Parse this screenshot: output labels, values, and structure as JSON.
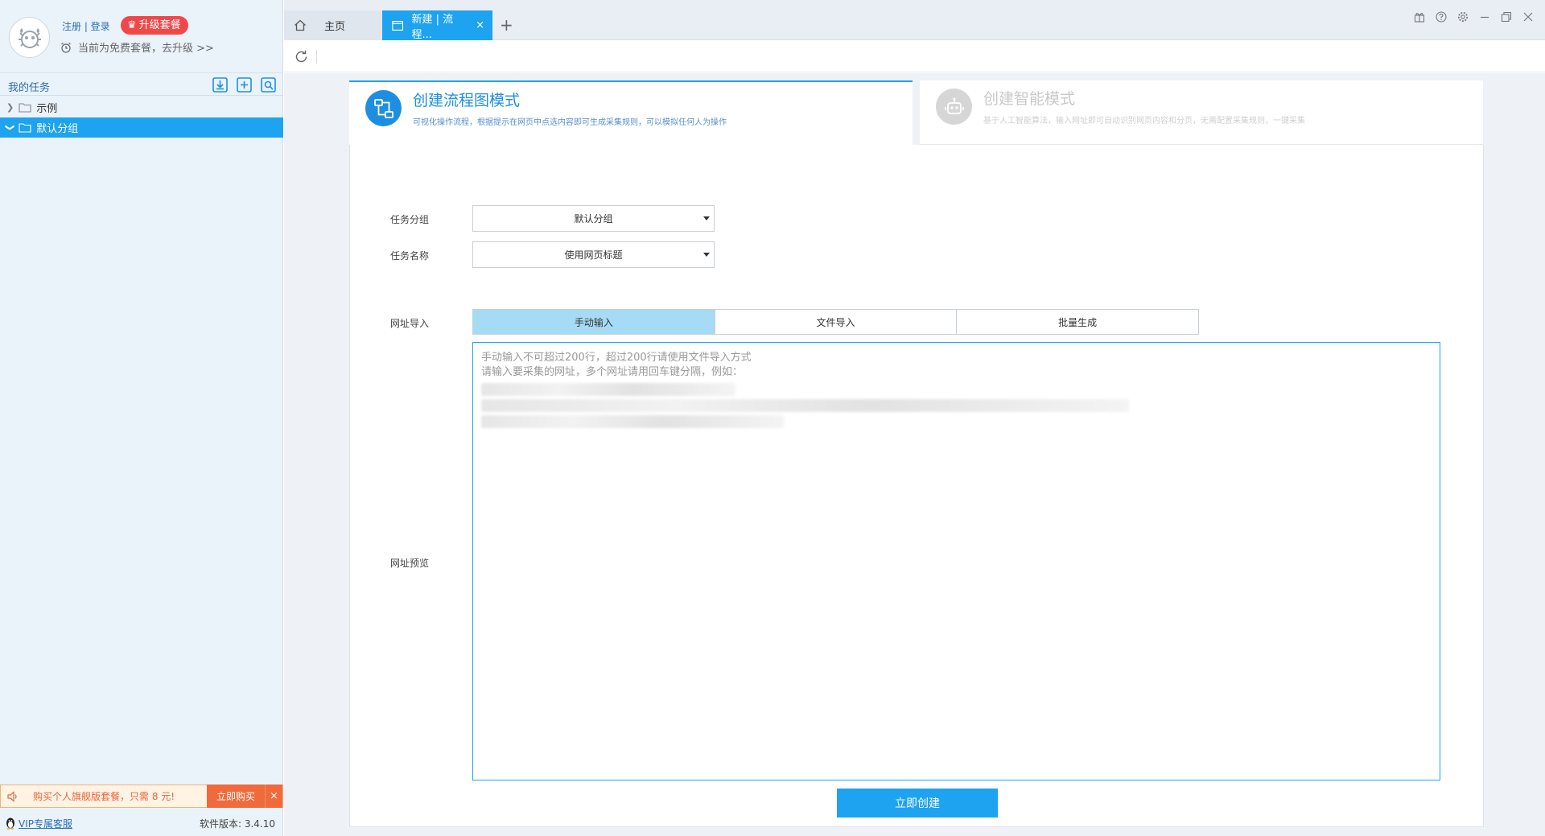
{
  "profile": {
    "register_login": "注册 | 登录",
    "upgrade_label": "升级套餐",
    "plan_notice": "当前为免费套餐，去升级 >>"
  },
  "sidebar": {
    "section_title": "我的任务",
    "tree": [
      {
        "label": "示例",
        "expanded": false
      },
      {
        "label": "默认分组",
        "expanded": true
      }
    ],
    "promo_text": "购买个人旗舰版套餐，只需 8 元!",
    "promo_buy": "立即购买",
    "promo_close": "×",
    "vip_link": "VIP专属客服",
    "version": "软件版本: 3.4.10"
  },
  "tabs": {
    "home": "主页",
    "current": "新建 | 流程...",
    "close": "×",
    "add": "+"
  },
  "modes": {
    "flow": {
      "title": "创建流程图模式",
      "desc": "可视化操作流程，根据提示在网页中点选内容即可生成采集规则，可以模拟任何人为操作"
    },
    "smart": {
      "title": "创建智能模式",
      "desc": "基于人工智能算法，输入网址即可自动识别网页内容和分页，无需配置采集规则，一键采集"
    }
  },
  "form": {
    "group_label": "任务分组",
    "group_value": "默认分组",
    "name_label": "任务名称",
    "name_value": "使用网页标题",
    "import_label": "网址导入",
    "import_options": [
      "手动输入",
      "文件导入",
      "批量生成"
    ],
    "preview_label": "网址预览",
    "placeholder_line1": "手动输入不可超过200行，超过200行请使用文件导入方式",
    "placeholder_line2": "请输入要采集的网址，多个网址请用回车键分隔，例如：",
    "submit": "立即创建"
  },
  "colors": {
    "accent": "#1da3ef",
    "promo": "#f06a3c",
    "badge": "#f04848"
  }
}
